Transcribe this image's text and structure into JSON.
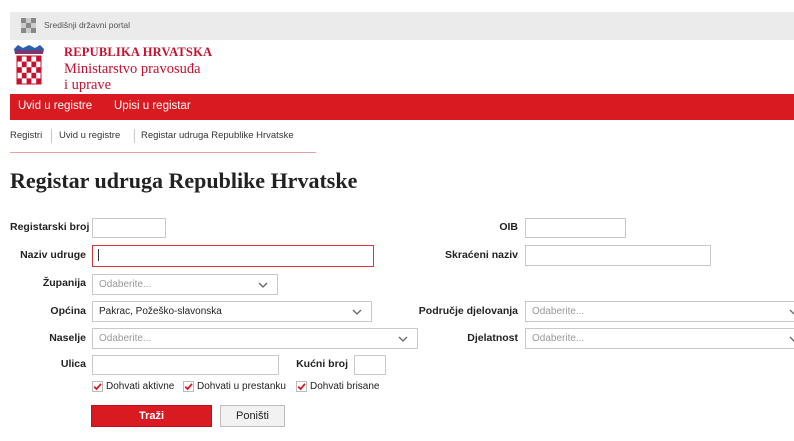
{
  "header": {
    "portal_label": "Središnji državni portal",
    "org_line1": "REPUBLIKA HRVATSKA",
    "org_line2": "Ministarstvo pravosuđa",
    "org_line3": "i uprave"
  },
  "nav": {
    "items": [
      {
        "label": "Uvid u registre"
      },
      {
        "label": "Upisi u registar"
      }
    ]
  },
  "breadcrumb": {
    "items": [
      "Registri",
      "Uvid u registre",
      "Registar udruga Republike Hrvatske"
    ]
  },
  "page": {
    "title": "Registar udruga Republike Hrvatske"
  },
  "form": {
    "registarski_broj": {
      "label": "Registarski broj",
      "value": ""
    },
    "oib": {
      "label": "OIB",
      "value": ""
    },
    "naziv_udruge": {
      "label": "Naziv udruge",
      "value": ""
    },
    "skraceni_naziv": {
      "label": "Skraćeni naziv",
      "value": ""
    },
    "zupanija": {
      "label": "Županija",
      "value": "Odaberite..."
    },
    "opcina": {
      "label": "Općina",
      "value": "Pakrac, Požeško-slavonska"
    },
    "podrucje_djelovanja": {
      "label": "Područje djelovanja",
      "value": "Odaberite..."
    },
    "naselje": {
      "label": "Naselje",
      "value": "Odaberite..."
    },
    "djelatnost": {
      "label": "Djelatnost",
      "value": "Odaberite..."
    },
    "ulica": {
      "label": "Ulica",
      "value": ""
    },
    "kucni_broj": {
      "label": "Kućni broj",
      "value": ""
    },
    "checkboxes": [
      {
        "label": "Dohvati aktivne",
        "checked": true
      },
      {
        "label": "Dohvati u prestanku",
        "checked": true
      },
      {
        "label": "Dohvati brisane",
        "checked": true
      }
    ],
    "search_label": "Traži",
    "reset_label": "Poništi"
  },
  "colors": {
    "brand_red": "#da1a21",
    "title_red": "#c8102e"
  }
}
